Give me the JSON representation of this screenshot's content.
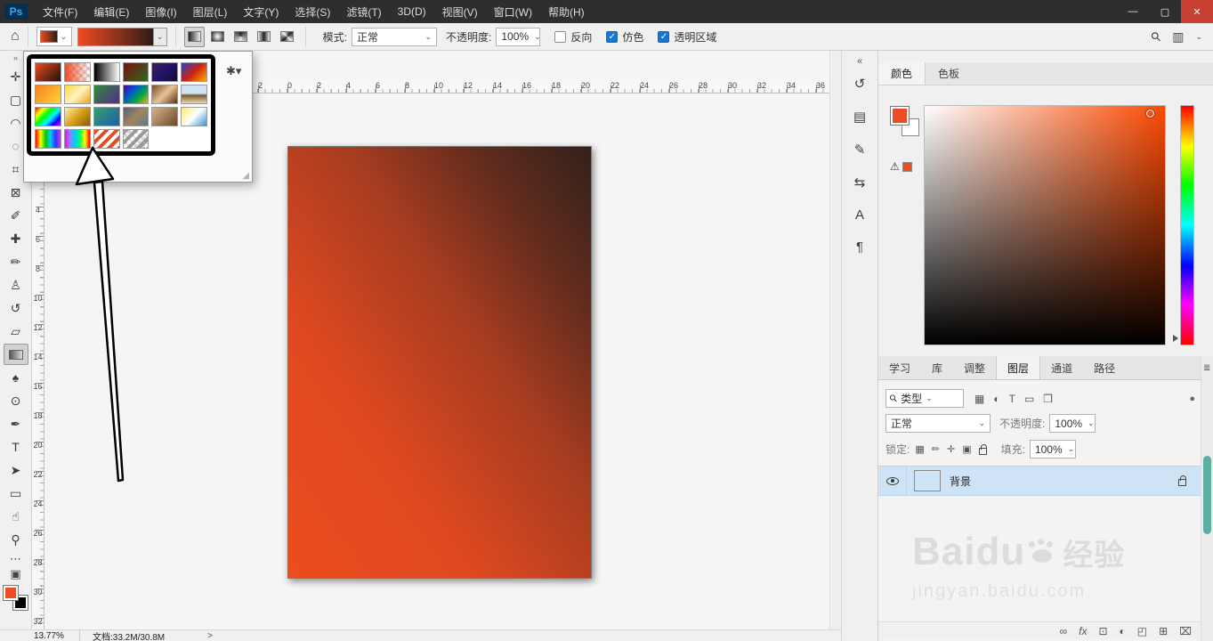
{
  "ui": {
    "caret": "⌄",
    "check": "✓",
    "grip": "◢"
  },
  "menu_bar": {
    "logo": "Ps",
    "close_color": "#c84031",
    "items": [
      {
        "name": "menu-file",
        "label": "文件(F)"
      },
      {
        "name": "menu-edit",
        "label": "编辑(E)"
      },
      {
        "name": "menu-image",
        "label": "图像(I)"
      },
      {
        "name": "menu-layer",
        "label": "图层(L)"
      },
      {
        "name": "menu-type",
        "label": "文字(Y)"
      },
      {
        "name": "menu-select",
        "label": "选择(S)"
      },
      {
        "name": "menu-filter",
        "label": "滤镜(T)"
      },
      {
        "name": "menu-3d",
        "label": "3D(D)"
      },
      {
        "name": "menu-view",
        "label": "视图(V)"
      },
      {
        "name": "menu-window",
        "label": "窗口(W)"
      },
      {
        "name": "menu-help",
        "label": "帮助(H)"
      }
    ],
    "window_controls": [
      {
        "name": "minimize-button",
        "glyph": "—"
      },
      {
        "name": "restore-button",
        "glyph": "▢"
      },
      {
        "name": "close-button",
        "glyph": "✕"
      }
    ]
  },
  "options_bar": {
    "home_icon": "⌂",
    "gradient_css": "linear-gradient(to right,#ef4b23,#6b2a1a 70%,#2d1b14)",
    "mode_label": "模式:",
    "mode_value": "正常",
    "opacity_label": "不透明度:",
    "opacity_value": "100%",
    "checkboxes": [
      {
        "name": "reverse-checkbox",
        "label": "反向",
        "checked": false
      },
      {
        "name": "dither-checkbox",
        "label": "仿色",
        "checked": true
      },
      {
        "name": "transparency-checkbox",
        "label": "透明区域",
        "checked": true
      }
    ],
    "type_buttons": [
      {
        "name": "linear-gradient-button",
        "css": "linear-gradient(90deg,#222,#eee)",
        "selected": true
      },
      {
        "name": "radial-gradient-button",
        "css": "radial-gradient(circle,#eee 10%,#222)",
        "selected": false
      },
      {
        "name": "angle-gradient-button",
        "css": "conic-gradient(#222,#eee,#222)",
        "selected": false
      },
      {
        "name": "reflected-gradient-button",
        "css": "linear-gradient(90deg,#eee,#222,#eee)",
        "selected": false
      },
      {
        "name": "diamond-gradient-button",
        "css": "conic-gradient(from 45deg,#222,#eee,#222,#eee,#222)",
        "selected": false
      }
    ],
    "search_icon": "⚲",
    "workspace_icon": "▥"
  },
  "gradient_picker": {
    "gear_icon": "✱▾",
    "swatches": [
      {
        "name": "gradient-fg-to-bg",
        "css": "linear-gradient(135deg,#ef4b23,#20100a)"
      },
      {
        "name": "gradient-fg-to-transparent",
        "checker": true,
        "css": "linear-gradient(to right,#ef4b23,rgba(239,75,35,0))"
      },
      {
        "name": "gradient-black-white",
        "css": "linear-gradient(to right,#000,#fff)"
      },
      {
        "name": "gradient-red-green",
        "css": "linear-gradient(135deg,#7a1010,#2d6a1e)"
      },
      {
        "name": "gradient-violet-blue",
        "css": "linear-gradient(135deg,#3b1c5a,#24126b,#101030)"
      },
      {
        "name": "gradient-blue-red-yellow",
        "css": "linear-gradient(135deg,#2244cc,#cc2211,#ffaa00)"
      },
      {
        "name": "gradient-orange-yellow",
        "css": "linear-gradient(135deg,#f7801e,#ffd43a)"
      },
      {
        "name": "gradient-yellow-white",
        "css": "linear-gradient(135deg,#ffd43a,#fff4c0,#f0a020)"
      },
      {
        "name": "gradient-green-purple",
        "css": "linear-gradient(135deg,#2d8c3c,#5a2a8c)"
      },
      {
        "name": "gradient-spectrum-dark",
        "css": "linear-gradient(135deg,#5500aa,#0055cc,#00aa44,#ffaa00)"
      },
      {
        "name": "gradient-copper",
        "css": "linear-gradient(135deg,#7a4a1e,#e8c49a,#5a3212)"
      },
      {
        "name": "gradient-chrome",
        "css": "linear-gradient(180deg,#cfe4f0 45%,#7a5a30 55%,#e8d8b0)"
      },
      {
        "name": "gradient-spectrum",
        "css": "linear-gradient(135deg,#f00,#ff0,#0f0,#0ff,#00f,#f0f)"
      },
      {
        "name": "gradient-gold",
        "css": "linear-gradient(135deg,#fff0b0,#d8a018,#8a5a10)"
      },
      {
        "name": "gradient-green-blue",
        "css": "linear-gradient(135deg,#35a06a,#1b5fae)"
      },
      {
        "name": "gradient-muted-multi",
        "css": "linear-gradient(135deg,#556077,#a08560,#607a88)"
      },
      {
        "name": "gradient-tan-brown",
        "css": "linear-gradient(135deg,#d8b48a,#6a4a2a)"
      },
      {
        "name": "gradient-yellow-blue",
        "css": "linear-gradient(135deg,#ffe873,#ffffff,#3a8fd8)"
      },
      {
        "name": "gradient-rainbow-1",
        "css": "linear-gradient(to right,#f00,#ff0,#0c0,#0cf,#33f,#c3f)"
      },
      {
        "name": "gradient-rainbow-2",
        "css": "linear-gradient(to right,#f0f,#88f,#0cf,#0f6,#ff0,#f00)"
      },
      {
        "name": "gradient-red-stripes",
        "css": "repeating-linear-gradient(135deg,#e84b1f 0 4px,#ffffff 4px 8px)"
      },
      {
        "name": "gradient-transparent-stripes",
        "checker": true,
        "css": "repeating-linear-gradient(135deg,rgba(140,140,140,0.85) 0 4px,rgba(255,255,255,0.15) 4px 8px)"
      }
    ]
  },
  "toolbar": {
    "collapse_icon": "»",
    "fg_color": "#ef4b23",
    "bg_color": "#000000",
    "ellipsis_icon": "⋯",
    "screen_icon": "▣",
    "tools": [
      {
        "name": "move-tool",
        "glyph": "✛"
      },
      {
        "name": "marquee-tool",
        "glyph": "▢"
      },
      {
        "name": "lasso-tool",
        "glyph": "◠"
      },
      {
        "name": "quick-selection-tool",
        "glyph": "◌"
      },
      {
        "name": "crop-tool",
        "glyph": "⌗"
      },
      {
        "name": "frame-tool",
        "glyph": "⊠"
      },
      {
        "name": "eyedropper-tool",
        "glyph": "✐"
      },
      {
        "name": "healing-brush-tool",
        "glyph": "✚"
      },
      {
        "name": "brush-tool",
        "glyph": "✏"
      },
      {
        "name": "clone-stamp-tool",
        "glyph": "♙"
      },
      {
        "name": "history-brush-tool",
        "glyph": "↺"
      },
      {
        "name": "eraser-tool",
        "glyph": "▱"
      },
      {
        "name": "gradient-tool",
        "css": "linear-gradient(90deg,#555,#ddd)",
        "selected": true
      },
      {
        "name": "blur-tool",
        "glyph": "♠"
      },
      {
        "name": "dodge-tool",
        "glyph": "⊙"
      },
      {
        "name": "pen-tool",
        "glyph": "✒"
      },
      {
        "name": "type-tool",
        "glyph": "T"
      },
      {
        "name": "path-selection-tool",
        "glyph": "➤"
      },
      {
        "name": "shape-tool",
        "glyph": "▭"
      },
      {
        "name": "hand-tool",
        "glyph": "☝"
      },
      {
        "name": "zoom-tool",
        "glyph": "⚲"
      }
    ]
  },
  "rulers": {
    "h_labels": [
      "2",
      "0",
      "2",
      "4",
      "6",
      "8",
      "10",
      "12",
      "14",
      "16",
      "18",
      "20",
      "22",
      "24",
      "26",
      "28",
      "30",
      "32",
      "34",
      "36"
    ],
    "v_labels": [
      "4",
      "6",
      "8",
      "10",
      "12",
      "14",
      "16",
      "18",
      "20",
      "22",
      "24",
      "26",
      "28",
      "30",
      "32"
    ]
  },
  "canvas": {
    "doc_gradient": "linear-gradient(to top right,#ec4d1e 0%,#e04920 30%,#a63c20 60%,#5e2b1d 82%,#33211b 100%)"
  },
  "collapsed_strip": {
    "collapse_icon": "«",
    "icons": [
      {
        "name": "history-panel-icon",
        "glyph": "↺"
      },
      {
        "name": "properties-panel-icon",
        "glyph": "▤"
      },
      {
        "name": "brush-settings-panel-icon",
        "glyph": "✎"
      },
      {
        "name": "clone-source-panel-icon",
        "glyph": "⇆"
      },
      {
        "name": "character-panel-icon",
        "glyph": "A"
      },
      {
        "name": "paragraph-panel-icon",
        "glyph": "¶"
      }
    ]
  },
  "color_panel": {
    "tabs": [
      {
        "name": "tab-color",
        "label": "颜色",
        "active": true
      },
      {
        "name": "tab-swatches",
        "label": "色板",
        "active": false
      }
    ],
    "fg": "#ef4b23",
    "bg": "#ffffff",
    "warning_icon": "⚠",
    "field_css": "linear-gradient(to top,#000,rgba(0,0,0,0)),linear-gradient(to right,#fff,#fd4a02)",
    "hue_css": "linear-gradient(to bottom,#f00 0%,#ff0 17%,#0f0 33%,#0ff 50%,#00f 67%,#f0f 83%,#f00 100%)"
  },
  "panel_tabs": [
    {
      "name": "tab-learn",
      "label": "学习",
      "active": false
    },
    {
      "name": "tab-libraries",
      "label": "库",
      "active": false
    },
    {
      "name": "tab-adjustments",
      "label": "调整",
      "active": false
    },
    {
      "name": "tab-layers",
      "label": "图层",
      "active": true
    },
    {
      "name": "tab-channels",
      "label": "通道",
      "active": false
    },
    {
      "name": "tab-paths",
      "label": "路径",
      "active": false
    }
  ],
  "layers_panel": {
    "menu_icon": "≣",
    "search_icon": "⚲",
    "filter_value": "类型",
    "filter_toggle_icon": "●",
    "filter_icons": [
      {
        "name": "filter-pixel-icon",
        "glyph": "▦"
      },
      {
        "name": "filter-adjustment-icon",
        "glyph": "◐"
      },
      {
        "name": "filter-type-icon",
        "glyph": "T"
      },
      {
        "name": "filter-shape-icon",
        "glyph": "▭"
      },
      {
        "name": "filter-smart-object-icon",
        "glyph": "❒"
      }
    ],
    "blend_mode": "正常",
    "opacity_label": "不透明度:",
    "opacity_value": "100%",
    "lock_label": "锁定:",
    "lock_icons": [
      {
        "name": "lock-transparency-icon",
        "glyph": "▦"
      },
      {
        "name": "lock-pixels-icon",
        "glyph": "✏"
      },
      {
        "name": "lock-position-icon",
        "glyph": "✛"
      },
      {
        "name": "lock-artboard-icon",
        "glyph": "▣"
      }
    ],
    "fill_label": "填充:",
    "fill_value": "100%",
    "layer": {
      "name": "背景"
    },
    "bottom_icons": [
      {
        "name": "link-layers-icon",
        "glyph": "∞"
      },
      {
        "name": "layer-effects-icon",
        "glyph": "fx"
      },
      {
        "name": "layer-mask-icon",
        "glyph": "⊡"
      },
      {
        "name": "adjustment-layer-icon",
        "glyph": "◐"
      },
      {
        "name": "layer-group-icon",
        "glyph": "◰"
      },
      {
        "name": "new-layer-icon",
        "glyph": "⊞"
      },
      {
        "name": "delete-layer-icon",
        "glyph": "⌧"
      }
    ],
    "scrollbar_color": "#5ab1a2"
  },
  "watermark": {
    "brand": "Baidu",
    "cn": "经验",
    "url": "jingyan.baidu.com"
  },
  "status_bar": {
    "zoom": "13.77%",
    "doc_info": "文档:33.2M/30.8M",
    "chevron": ">"
  }
}
